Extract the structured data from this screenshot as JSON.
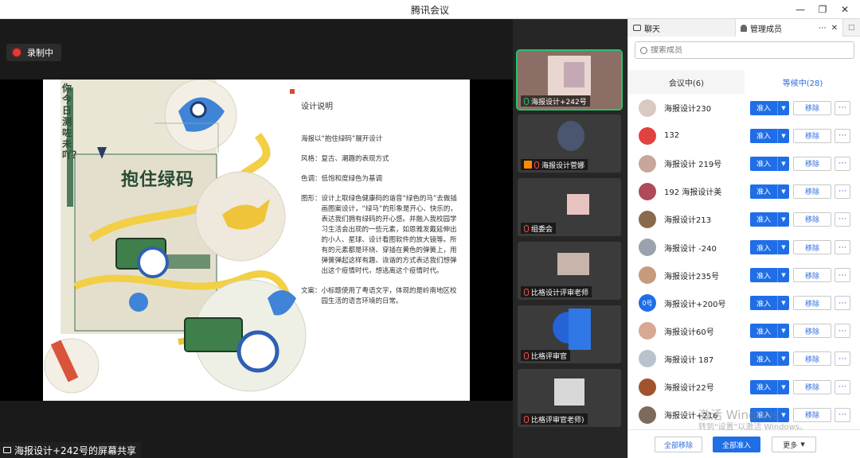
{
  "window": {
    "title": "腾讯会议"
  },
  "recording": {
    "label": "录制中"
  },
  "share": {
    "caption": "海报设计+242号的屏幕共享"
  },
  "slide": {
    "poster_side_text": "你今日测咗未吖？",
    "poster_title": "抱住绿码",
    "heading": "设计说明",
    "intro": "海报以“抱住绿码”展开设计",
    "rows": [
      {
        "key": "风格：",
        "value": "复古、潮趣的表现方式"
      },
      {
        "key": "色调：",
        "value": "低饱和度绿色为基调"
      },
      {
        "key": "图形：",
        "value": "设计上取绿色健康码的谐音“绿色的马”去做插画图案设计，“绿马”的形象是开心、快乐的，表达我们拥有绿码的开心感。并融入我校园学习生活会出现的一些元素，如恩雅发戴延伸出的小人、星球、设计看图软件的放大镜等。所有的元素都是环绕、穿插在黄色的弹簧上，用弹簧弹起这样有趣、诙谐的方式表达我们想弹出这个疫情时代，想逃离这个疫情时代。"
      },
      {
        "key": "文案：",
        "value": "小标题使用了粤语文字，体现的是岭南地区校园生活的语言环境的日常。"
      }
    ]
  },
  "video_tiles": [
    {
      "name": "海报设计+242号",
      "mic": "on",
      "active": true
    },
    {
      "name": "海报设计菅娜",
      "mic": "off",
      "active": false
    },
    {
      "name": "组委会",
      "mic": "off",
      "active": false
    },
    {
      "name": "比格设计评审老师",
      "mic": "off",
      "active": false
    },
    {
      "name": "比格评审官",
      "mic": "off",
      "active": false
    },
    {
      "name": "比格评审官老师)",
      "mic": "off",
      "active": false
    }
  ],
  "panel": {
    "tab_chat": "聊天",
    "tab_members": "管理成员",
    "search_placeholder": "搜索成员",
    "tab_in_meeting": "会议中(6)",
    "tab_waiting": "等候中(28)",
    "admit_label": "准入",
    "remove_label": "移除",
    "members": [
      {
        "name": "海报设计230",
        "avatar": "#d9c9c0"
      },
      {
        "name": "132",
        "avatar": "#e0433f"
      },
      {
        "name": "海报设计 219号",
        "avatar": "#c7a79b"
      },
      {
        "name": "192 海报设计美",
        "avatar": "#b04a5a"
      },
      {
        "name": "海报设计213",
        "avatar": "#8a6a4c"
      },
      {
        "name": "海报设计 -240",
        "avatar": "#9aa3ad"
      },
      {
        "name": "海报设计235号",
        "avatar": "#c69b7b"
      },
      {
        "name": "海报设计+200号",
        "avatar": "#1f6ee8",
        "avatar_text": "0号"
      },
      {
        "name": "海报设计60号",
        "avatar": "#d8a894"
      },
      {
        "name": "海报设计 187",
        "avatar": "#b9c3cd"
      },
      {
        "name": "海报设计22号",
        "avatar": "#a0532e"
      },
      {
        "name": "海报设计+216",
        "avatar": "#7d6a5a"
      }
    ],
    "remove_all": "全部移除",
    "admit_all": "全部准入",
    "more": "更多"
  },
  "watermark": {
    "line1": "激活 Windows",
    "line2": "转到\"设置\"以激活 Windows。"
  }
}
